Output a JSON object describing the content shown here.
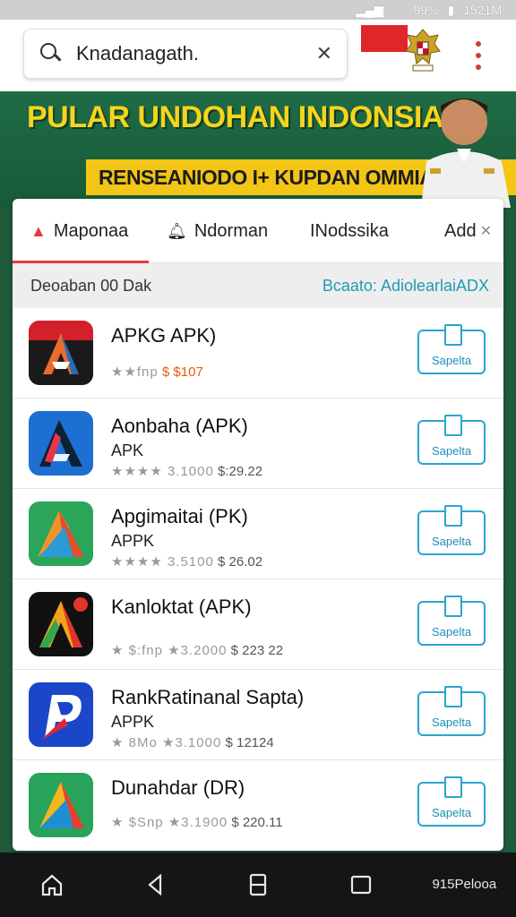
{
  "status": {
    "battery": "99%",
    "time": "1521M"
  },
  "search": {
    "value": "Knadanagath.",
    "clear_label": "✕"
  },
  "banner": {
    "title": "PULAR UNDOHAN INDONSIA",
    "ribbon": "RENSEANIODO I+ KUPDAN OMMIALIN"
  },
  "tabs": [
    {
      "label": "Maponaa",
      "icon": "home-icon"
    },
    {
      "label": "Ndorman",
      "icon": "bell-icon"
    },
    {
      "label": "INodssika",
      "icon": ""
    },
    {
      "label": "Add",
      "icon": "close-icon"
    }
  ],
  "subheader": {
    "left": "Deoaban 00 Dak",
    "right": "Bcaato: AdiolearlaiADX"
  },
  "apps": [
    {
      "name": "APKG APK)",
      "sub": "",
      "meta_prefix": "★★fnp",
      "price": "$ $107",
      "button": "Sapelta"
    },
    {
      "name": "Aonbaha (APK)",
      "sub": "APK",
      "meta_prefix": "★★★★ 3.1000",
      "price": "$:29.22",
      "button": "Sapelta"
    },
    {
      "name": "Apgimaitai (PK)",
      "sub": "APPK",
      "meta_prefix": "★★★★ 3.5100",
      "price": "$ 26.02",
      "button": "Sapelta"
    },
    {
      "name": "Kanloktat (APK)",
      "sub": "",
      "meta_prefix": "★ $:fnp ★3.2000",
      "price": "$ 223 22",
      "button": "Sapelta"
    },
    {
      "name": "RankRatinanal Sapta)",
      "sub": "APPK",
      "meta_prefix": "★ 8Mo ★3.1000",
      "price": "$ 12124",
      "button": "Sapelta"
    },
    {
      "name": "Dunahdar (DR)",
      "sub": "",
      "meta_prefix": "★ $Snp ★3.1900",
      "price": "$ 220.11",
      "button": "Sapelta"
    }
  ],
  "navbar": {
    "clock_top": "915",
    "clock_bottom": "Pelooa"
  },
  "colors": {
    "accent": "#e33b3b",
    "button": "#2aa5cf",
    "banner": "#1f6b45",
    "ribbon": "#f3c514"
  }
}
